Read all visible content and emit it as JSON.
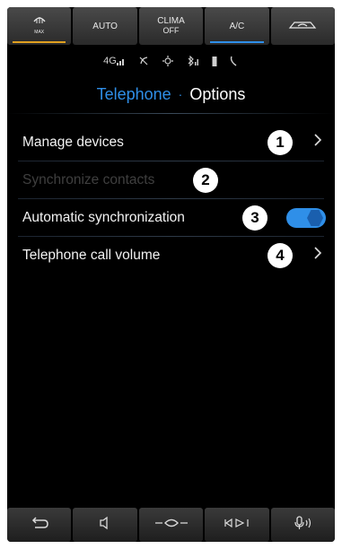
{
  "climate": {
    "buttons": [
      {
        "label": "MAX",
        "icon": "defrost-max-icon"
      },
      {
        "label": "AUTO"
      },
      {
        "label": "CLIMA",
        "sub": "OFF"
      },
      {
        "label": "A/C"
      },
      {
        "icon": "recirculation-icon"
      }
    ]
  },
  "status": {
    "network": "4G",
    "icons": [
      "signal-bars-icon",
      "do-not-disturb-icon",
      "sync-icon",
      "bluetooth-icon",
      "battery-icon",
      "phone-icon"
    ]
  },
  "header": {
    "crumb": "Telephone",
    "separator": "·",
    "title": "Options"
  },
  "menu": {
    "items": [
      {
        "label": "Manage devices",
        "badge": "1",
        "control": "chevron"
      },
      {
        "label": "Synchronize contacts",
        "badge": "2",
        "control": "none",
        "disabled": true
      },
      {
        "label": "Automatic synchronization",
        "badge": "3",
        "control": "toggle",
        "toggle_state": "on"
      },
      {
        "label": "Telephone call volume",
        "badge": "4",
        "control": "chevron"
      }
    ]
  },
  "bottom_nav": {
    "items": [
      "back-icon",
      "speaker-icon",
      "home-icon",
      "media-icon",
      "voice-icon"
    ]
  },
  "colors": {
    "accent": "#2f8fe8",
    "orange": "#e0a020",
    "background": "#000000"
  }
}
